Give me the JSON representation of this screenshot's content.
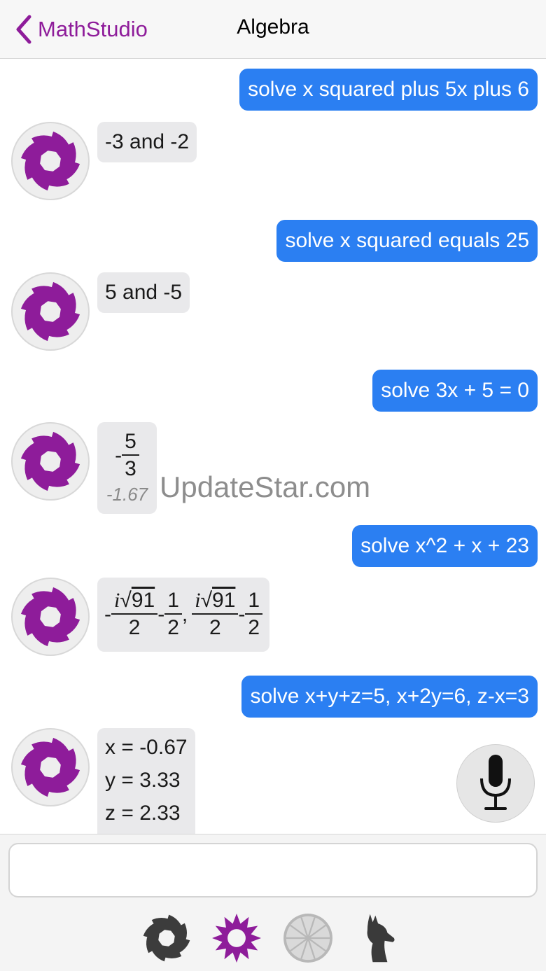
{
  "nav": {
    "back_label": "MathStudio",
    "title": "Algebra"
  },
  "messages": [
    {
      "user": "solve x squared plus 5x plus 6",
      "bot": "-3 and -2"
    },
    {
      "user": "solve x squared equals 25",
      "bot": "5 and -5"
    },
    {
      "user": "solve 3x + 5 = 0",
      "bot": {
        "sign": "-",
        "num": "5",
        "den": "3",
        "approx": "-1.67"
      }
    },
    {
      "user": "solve x^2 + x + 23",
      "bot": {
        "i": "i",
        "radicand": "91",
        "two": "2",
        "one": "1",
        "minus": "-",
        "comma": ","
      }
    },
    {
      "user": "solve x+y+z=5, x+2y=6, z-x=3",
      "bot": [
        "x = -0.67",
        "y = 3.33",
        "z = 2.33"
      ]
    }
  ],
  "watermark": "UpdateStar.com",
  "input": {
    "placeholder": ""
  },
  "tabs": [
    "graph-icon",
    "calculator-icon",
    "lime-icon",
    "llama-icon"
  ],
  "colors": {
    "accent": "#8e1c9a",
    "user_bubble": "#2b7ff2",
    "bot_bubble": "#e9e9eb"
  }
}
